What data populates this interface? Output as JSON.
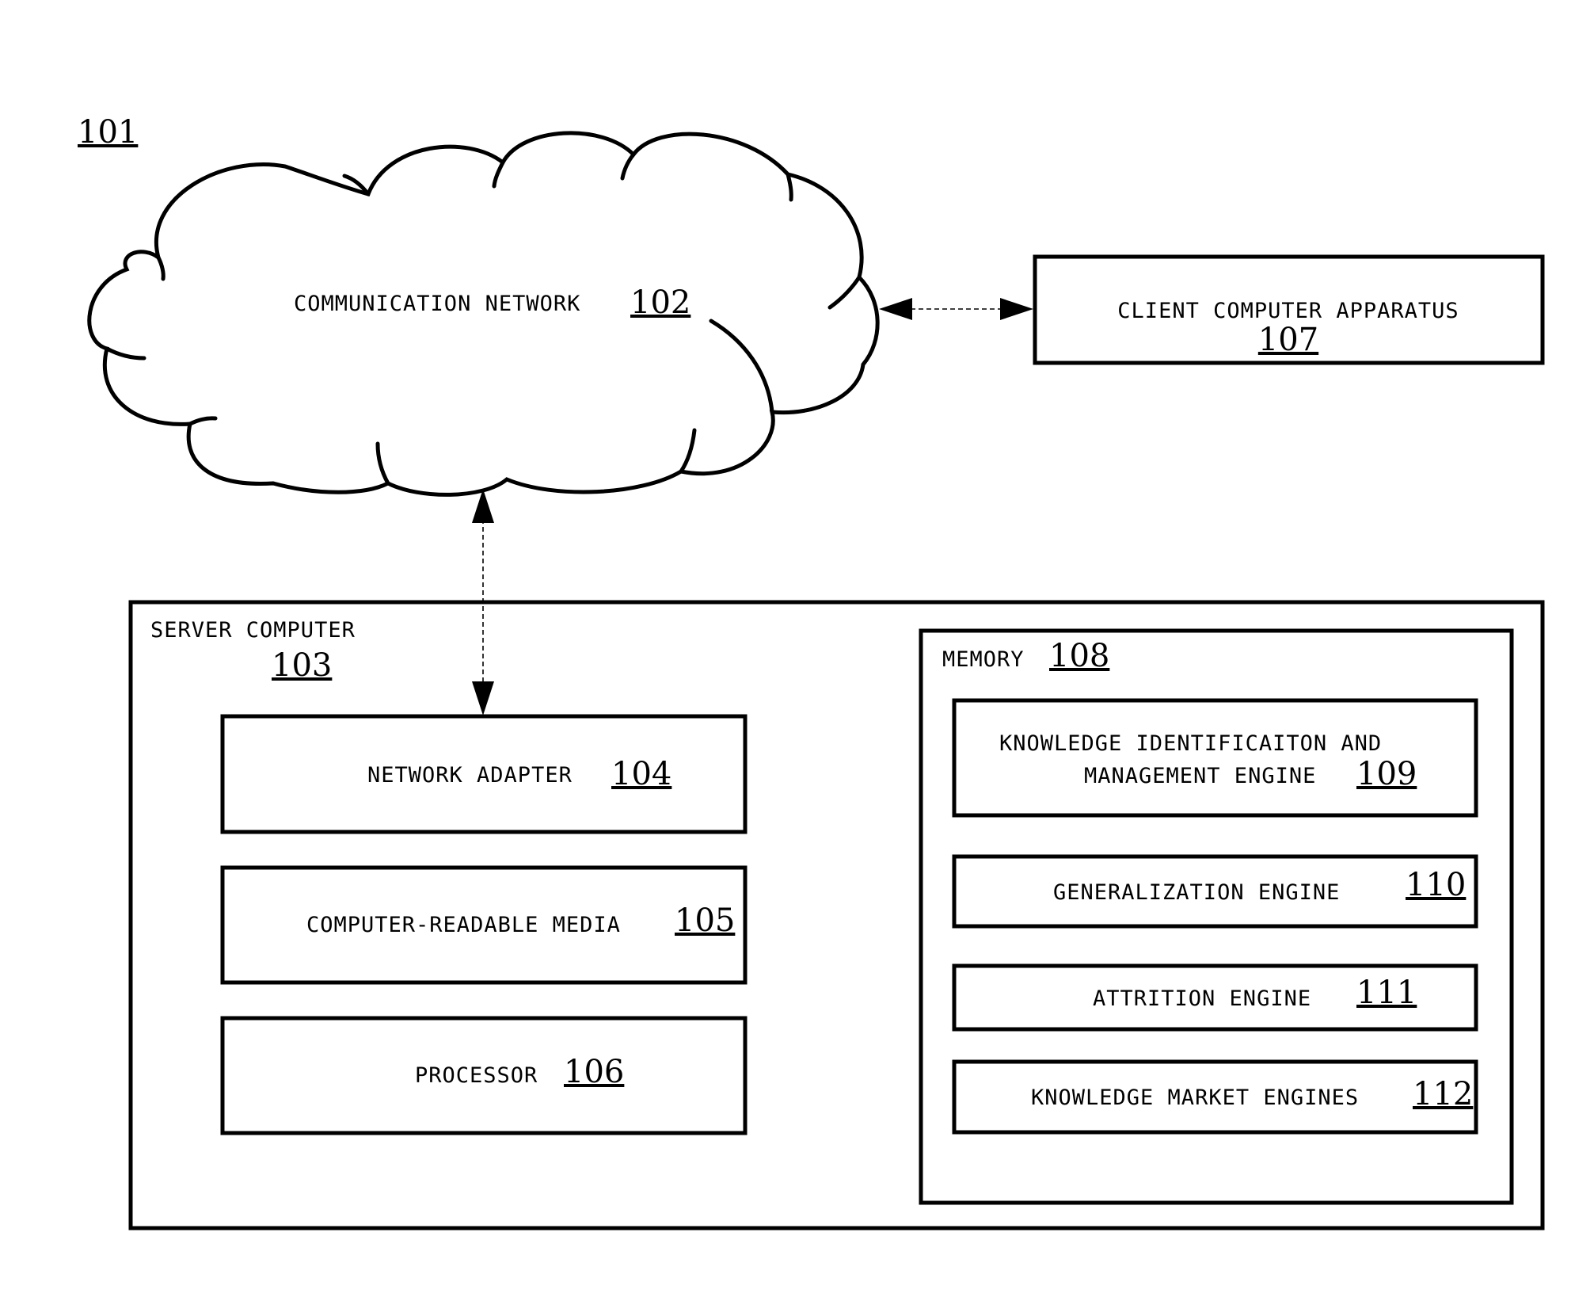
{
  "figure": {
    "ref": "101"
  },
  "network": {
    "label": "COMMUNICATION NETWORK",
    "ref": "102"
  },
  "client": {
    "label": "CLIENT COMPUTER APPARATUS",
    "ref": "107"
  },
  "server": {
    "label": "SERVER COMPUTER",
    "ref": "103",
    "components": [
      {
        "label": "NETWORK ADAPTER",
        "ref": "104"
      },
      {
        "label": "COMPUTER-READABLE MEDIA",
        "ref": "105"
      },
      {
        "label": "PROCESSOR",
        "ref": "106"
      }
    ],
    "memory": {
      "label": "MEMORY",
      "ref": "108",
      "engines": [
        {
          "label_line1": "KNOWLEDGE IDENTIFICAITON AND",
          "label_line2": "MANAGEMENT ENGINE",
          "ref": "109"
        },
        {
          "label": "GENERALIZATION ENGINE",
          "ref": "110"
        },
        {
          "label": "ATTRITION ENGINE",
          "ref": "111"
        },
        {
          "label": "KNOWLEDGE MARKET ENGINES",
          "ref": "112"
        }
      ]
    }
  },
  "connections": [
    {
      "from": "communication-network",
      "to": "client-computer-apparatus",
      "type": "bidirectional-dashed"
    },
    {
      "from": "communication-network",
      "to": "network-adapter",
      "type": "bidirectional-dashed"
    }
  ]
}
